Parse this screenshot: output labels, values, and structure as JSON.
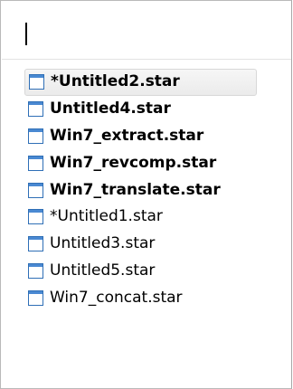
{
  "filter": {
    "value": "",
    "placeholder": ""
  },
  "colors": {
    "icon_border": "#2f6fb6",
    "icon_header": "#4a89d2",
    "selection_bg": "#ececec"
  },
  "files": [
    {
      "label": "*Untitled2.star",
      "bold": true,
      "selected": true,
      "icon": "document-window-icon"
    },
    {
      "label": "Untitled4.star",
      "bold": true,
      "selected": false,
      "icon": "document-window-icon"
    },
    {
      "label": "Win7_extract.star",
      "bold": true,
      "selected": false,
      "icon": "document-window-icon"
    },
    {
      "label": "Win7_revcomp.star",
      "bold": true,
      "selected": false,
      "icon": "document-window-icon"
    },
    {
      "label": "Win7_translate.star",
      "bold": true,
      "selected": false,
      "icon": "document-window-icon"
    },
    {
      "label": "*Untitled1.star",
      "bold": false,
      "selected": false,
      "icon": "document-window-icon"
    },
    {
      "label": "Untitled3.star",
      "bold": false,
      "selected": false,
      "icon": "document-window-icon"
    },
    {
      "label": "Untitled5.star",
      "bold": false,
      "selected": false,
      "icon": "document-window-icon"
    },
    {
      "label": "Win7_concat.star",
      "bold": false,
      "selected": false,
      "icon": "document-window-icon"
    }
  ]
}
